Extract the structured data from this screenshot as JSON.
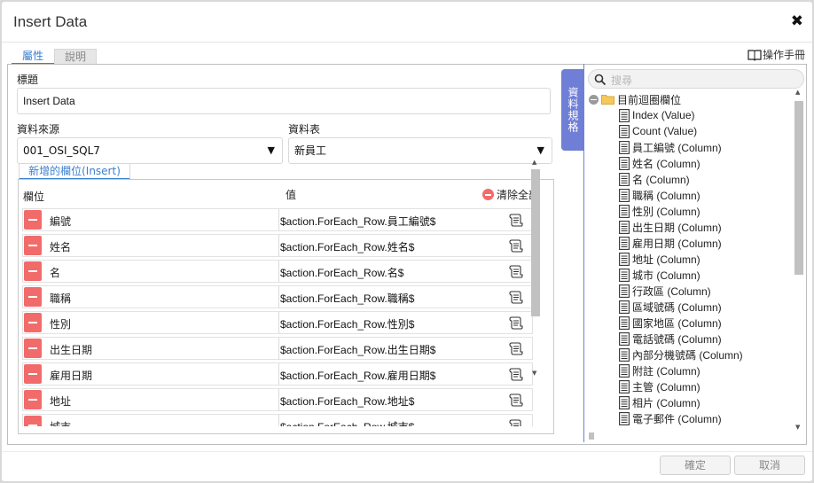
{
  "dialog": {
    "title": "Insert Data",
    "close_symbol": "✖"
  },
  "tabs": [
    {
      "label": "屬性",
      "active": true
    },
    {
      "label": "說明",
      "active": false
    }
  ],
  "manual_link": {
    "label": "操作手冊",
    "icon": "book-icon"
  },
  "form": {
    "title_label": "標題",
    "title_value": "Insert Data",
    "datasource_label": "資料來源",
    "datasource_value": "001_OSI_SQL7",
    "table_label": "資料表",
    "table_value": "新員工",
    "dropdown_arrow": "▼"
  },
  "insert_panel": {
    "tab_label": "新增的欄位(Insert)",
    "column_header": "欄位",
    "value_header": "值",
    "clear_all_label": "清除全部",
    "rows": [
      {
        "field": "編號",
        "value": "$action.ForEach_Row.員工編號$"
      },
      {
        "field": "姓名",
        "value": "$action.ForEach_Row.姓名$"
      },
      {
        "field": "名",
        "value": "$action.ForEach_Row.名$"
      },
      {
        "field": "職稱",
        "value": "$action.ForEach_Row.職稱$"
      },
      {
        "field": "性別",
        "value": "$action.ForEach_Row.性別$"
      },
      {
        "field": "出生日期",
        "value": "$action.ForEach_Row.出生日期$"
      },
      {
        "field": "雇用日期",
        "value": "$action.ForEach_Row.雇用日期$"
      },
      {
        "field": "地址",
        "value": "$action.ForEach_Row.地址$"
      },
      {
        "field": "城市",
        "value": "$action.ForEach_Row.城市$"
      }
    ]
  },
  "side_panel": {
    "spec_tab_label": "資料規格",
    "search_placeholder": "搜尋",
    "tree_root": "目前迴圈欄位",
    "tree_items": [
      "Index (Value)",
      "Count (Value)",
      "員工編號 (Column)",
      "姓名 (Column)",
      "名 (Column)",
      "職稱 (Column)",
      "性別 (Column)",
      "出生日期 (Column)",
      "雇用日期 (Column)",
      "地址 (Column)",
      "城市 (Column)",
      "行政區 (Column)",
      "區域號碼 (Column)",
      "國家地區 (Column)",
      "電話號碼 (Column)",
      "內部分機號碼 (Column)",
      "附註 (Column)",
      "主管 (Column)",
      "相片 (Column)",
      "電子郵件 (Column)"
    ]
  },
  "footer": {
    "ok_label": "確定",
    "cancel_label": "取消"
  },
  "colors": {
    "accent": "#3b7fce",
    "delete_red": "#f26b6b",
    "spec_tab": "#6f7fd6"
  }
}
